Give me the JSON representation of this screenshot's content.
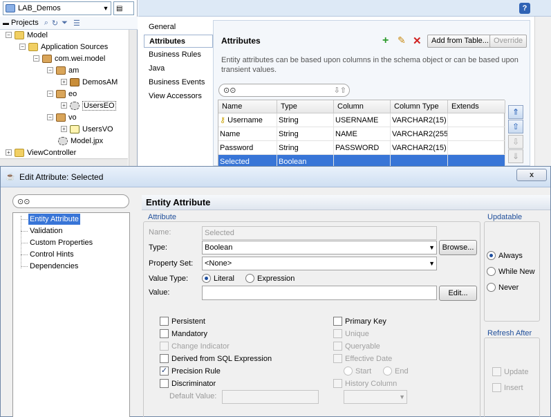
{
  "app_selector": {
    "value": "LAB_Demos"
  },
  "projects_tab": {
    "label": "Projects"
  },
  "tree": {
    "model": "Model",
    "app_sources": "Application Sources",
    "package": "com.wei.model",
    "am": "am",
    "demos_am": "DemosAM",
    "eo": "eo",
    "users_eo": "UsersEO",
    "vo": "vo",
    "users_vo": "UsersVO",
    "model_jpx": "Model.jpx",
    "view_controller": "ViewController"
  },
  "overview_nav": [
    "General",
    "Attributes",
    "Business Rules",
    "Java",
    "Business Events",
    "View Accessors"
  ],
  "attributes_panel": {
    "title": "Attributes",
    "description": "Entity attributes can be based upon columns in the schema object or can be based upon transient values.",
    "add_from_table": "Add from Table...",
    "override": "Override",
    "columns": [
      "Name",
      "Type",
      "Column",
      "Column Type",
      "Extends"
    ],
    "rows": [
      [
        "Username",
        "String",
        "USERNAME",
        "VARCHAR2(15)",
        ""
      ],
      [
        "Name",
        "String",
        "NAME",
        "VARCHAR2(255)",
        ""
      ],
      [
        "Password",
        "String",
        "PASSWORD",
        "VARCHAR2(15)",
        ""
      ],
      [
        "Selected",
        "Boolean",
        "",
        "",
        ""
      ]
    ]
  },
  "dialog": {
    "title": "Edit Attribute: Selected",
    "close": "x",
    "nav": [
      "Entity Attribute",
      "Validation",
      "Custom Properties",
      "Control Hints",
      "Dependencies"
    ],
    "header": "Entity Attribute",
    "attribute_group": "Attribute",
    "name_label": "Name:",
    "name_value": "Selected",
    "type_label": "Type:",
    "type_value": "Boolean",
    "browse": "Browse...",
    "property_set_label": "Property Set:",
    "property_set_value": "<None>",
    "value_type_label": "Value Type:",
    "literal": "Literal",
    "expression": "Expression",
    "value_label": "Value:",
    "edit": "Edit...",
    "checks_left": [
      {
        "label": "Persistent",
        "checked": false,
        "enabled": true
      },
      {
        "label": "Mandatory",
        "checked": false,
        "enabled": true
      },
      {
        "label": "Change Indicator",
        "checked": false,
        "enabled": false
      },
      {
        "label": "Derived from SQL Expression",
        "checked": false,
        "enabled": true
      },
      {
        "label": "Precision Rule",
        "checked": true,
        "enabled": true
      },
      {
        "label": "Discriminator",
        "checked": false,
        "enabled": true
      }
    ],
    "default_value_label": "Default Value:",
    "checks_right": [
      {
        "label": "Primary Key",
        "checked": false,
        "enabled": true
      },
      {
        "label": "Unique",
        "checked": false,
        "enabled": false
      },
      {
        "label": "Queryable",
        "checked": false,
        "enabled": false
      },
      {
        "label": "Effective Date",
        "checked": false,
        "enabled": false
      },
      {
        "label": "History Column",
        "checked": false,
        "enabled": false
      }
    ],
    "start": "Start",
    "end": "End",
    "updatable_group": "Updatable",
    "updatable_options": [
      "Always",
      "While New",
      "Never"
    ],
    "refresh_group": "Refresh After",
    "refresh_options": [
      "Update",
      "Insert"
    ]
  }
}
